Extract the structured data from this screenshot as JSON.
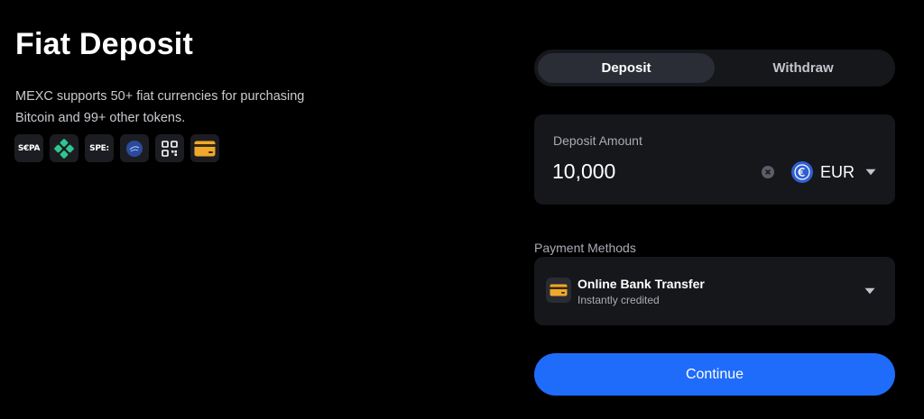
{
  "header": {
    "title": "Fiat Deposit",
    "description_line1": "MEXC supports 50+ fiat currencies for purchasing",
    "description_line2": "Bitcoin and 99+ other tokens."
  },
  "payment_icons": [
    {
      "icon": "sepa-icon",
      "text": "S€PA"
    },
    {
      "icon": "pix-icon"
    },
    {
      "icon": "spei-icon",
      "text": "SPE:"
    },
    {
      "icon": "fast-icon"
    },
    {
      "icon": "qr-code-icon"
    },
    {
      "icon": "bank-card-icon"
    }
  ],
  "tabs": [
    {
      "label": "Deposit",
      "active": true
    },
    {
      "label": "Withdraw",
      "active": false
    }
  ],
  "deposit": {
    "label": "Deposit Amount",
    "amount": "10,000",
    "currency": "EUR",
    "currency_symbol": "€"
  },
  "payment_methods": {
    "label": "Payment Methods",
    "selected": {
      "name": "Online Bank Transfer",
      "subtitle": "Instantly credited"
    }
  },
  "continue_label": "Continue",
  "colors": {
    "background": "#000000",
    "card": "#16171b",
    "accent": "#1f6cfb",
    "card_icon": "#f0a92c"
  }
}
